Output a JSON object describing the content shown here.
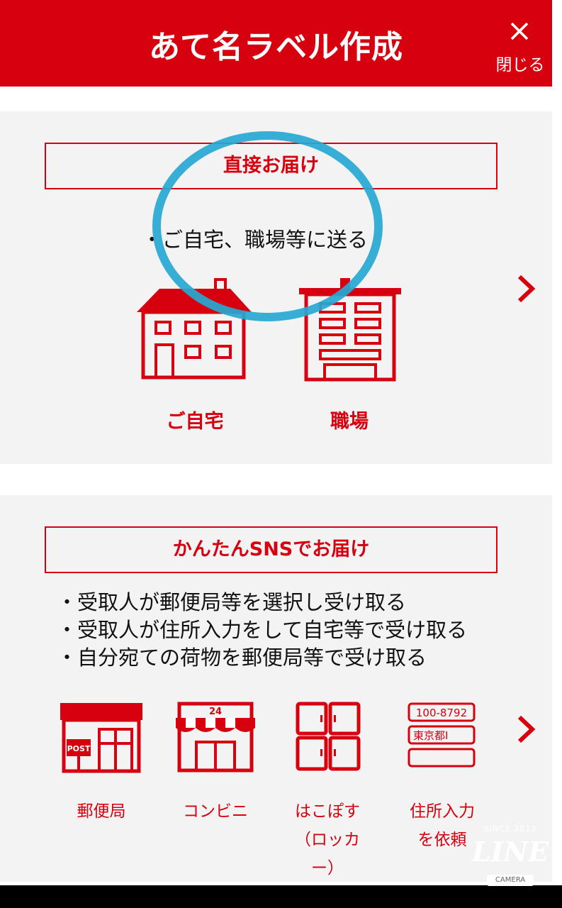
{
  "header": {
    "title": "あて名ラベル作成",
    "close_label": "閉じる"
  },
  "direct": {
    "title": "直接お届け",
    "description": "・ご自宅、職場等に送る",
    "options": [
      {
        "label": "ご自宅",
        "icon": "house-icon"
      },
      {
        "label": "職場",
        "icon": "office-building-icon"
      }
    ]
  },
  "sns": {
    "title": "かんたんSNSでお届け",
    "bullets": [
      "・受取人が郵便局等を選択し受け取る",
      "・受取人が住所入力をして自宅等で受け取る",
      "・自分宛ての荷物を郵便局等で受け取る"
    ],
    "options": [
      {
        "label": "郵便局",
        "icon": "post-office-icon"
      },
      {
        "label": "コンビニ",
        "icon": "convenience-store-icon",
        "sign": "24"
      },
      {
        "label_line1": "はこぽす",
        "label_line2": "（ロッカー）",
        "icon": "locker-icon"
      },
      {
        "label_line1": "住所入力",
        "label_line2": "を依頼",
        "icon": "address-form-icon",
        "postal": "100-8792",
        "address": "東京都I"
      }
    ],
    "post_sign": "POST"
  },
  "watermark": {
    "since": "SINCE 2012",
    "brand": "LINE",
    "sub": "CAMERA"
  },
  "colors": {
    "accent": "#d7000f",
    "background": "#f4f3f4",
    "highlight": "#26a8d3"
  }
}
